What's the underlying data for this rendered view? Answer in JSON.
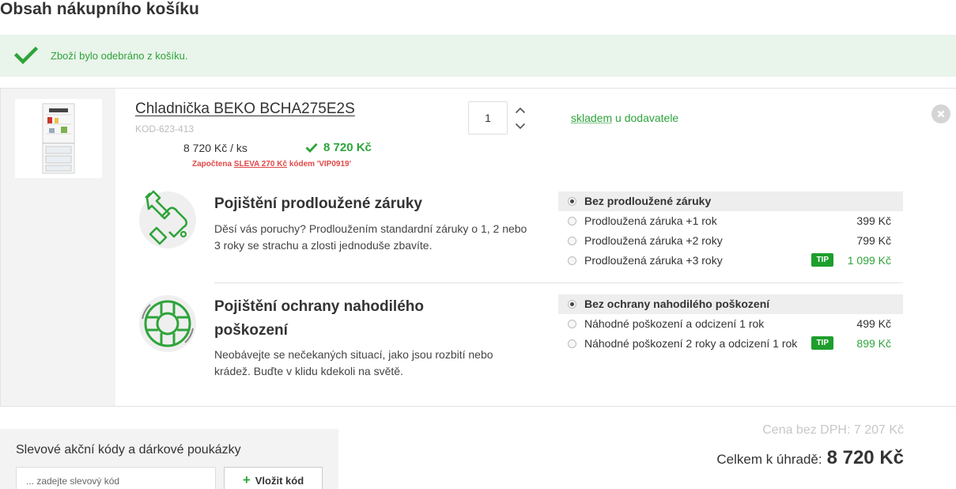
{
  "page": {
    "title": "Obsah nákupního košíku"
  },
  "alert": {
    "message": "Zboží bylo odebráno z košíku.",
    "icon": "checkmark-icon",
    "color": "#2ea43a"
  },
  "item": {
    "name": "Chladnička BEKO BCHA275E2S",
    "code": "KOD-623-413",
    "unit_price": "8 720 Kč / ks",
    "total_price": "8 720 Kč",
    "discount_prefix": "Započtena",
    "discount_link": "SLEVA 270 Kč",
    "discount_suffix": "kódem 'VIP0919'",
    "quantity": "1",
    "stock_link": "skladem",
    "stock_rest": " u dodavatele"
  },
  "services": [
    {
      "title": "Pojištění prodloužené záruky",
      "description": "Děsí vás poruchy? Prodloužením standardní záruky o 1, 2 nebo 3 roky se strachu a zlosti jednoduše zbavíte.",
      "icon": "wrench-hand-icon",
      "options": [
        {
          "label": "Bez prodloužené záruky",
          "price": "",
          "selected": true
        },
        {
          "label": "Prodloužená záruka +1 rok",
          "price": "399 Kč",
          "selected": false
        },
        {
          "label": "Prodloužená záruka +2 roky",
          "price": "799 Kč",
          "selected": false
        },
        {
          "label": "Prodloužená záruka +3 roky",
          "price": "1 099 Kč",
          "selected": false,
          "tip": "TIP"
        }
      ]
    },
    {
      "title": "Pojištění ochrany nahodilého poškození",
      "title_line1": "Pojištění ochrany nahodilého",
      "title_line2": "poškození",
      "description": "Neobávejte se nečekaných situací, jako jsou rozbití nebo krádež. Buďte v klidu kdekoli na světě.",
      "icon": "lifebuoy-icon",
      "options": [
        {
          "label": "Bez ochrany nahodilého poškození",
          "price": "",
          "selected": true
        },
        {
          "label": "Náhodné poškození a odcizení 1 rok",
          "price": "499 Kč",
          "selected": false
        },
        {
          "label": "Náhodné poškození 2 roky a odcizení 1 rok",
          "price": "899 Kč",
          "selected": false,
          "tip": "TIP"
        }
      ]
    }
  ],
  "codes": {
    "heading": "Slevové akční kódy a dárkové poukázky",
    "placeholder": "... zadejte slevový kód",
    "button": "Vložit kód"
  },
  "summary": {
    "price_no_vat": "Cena bez DPH: 7 207 Kč",
    "total_label": "Celkem k úhradě:",
    "total_amount": "8 720 Kč"
  }
}
